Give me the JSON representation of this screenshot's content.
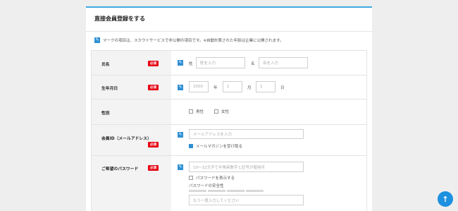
{
  "form": {
    "title": "直接会員登録をする",
    "notice": "マークの項目は、スカウトサービスで非公開の項目です。※自動計算された年齢は企業に公開されます。",
    "required_badge": "必須",
    "name": {
      "label": "氏名",
      "sei_label": "姓",
      "sei_placeholder": "姓を入力",
      "mei_label": "名",
      "mei_placeholder": "名を入力"
    },
    "birth": {
      "label": "生年月日",
      "year_placeholder": "2000",
      "year_unit": "年",
      "month_placeholder": "1",
      "month_unit": "月",
      "day_placeholder": "1",
      "day_unit": "日"
    },
    "gender": {
      "label": "性別",
      "options": [
        "男性",
        "女性"
      ]
    },
    "email": {
      "label": "会員ID（メールアドレス）",
      "placeholder": "メールアドレスを入力",
      "magazine_label": "メールマガジンを受け取る",
      "magazine_checked": true
    },
    "password": {
      "label": "ご希望のパスワード",
      "placeholder": "10～32文字で半角英数字と記号が使用可",
      "show_label": "パスワードを表示する",
      "strength_label": "パスワードの安全性",
      "confirm_placeholder": "もう一度入力してください"
    }
  },
  "icons": {
    "pen": "pencil-icon",
    "scroll_top": "arrow-up-icon"
  },
  "colors": {
    "accent": "#2f8fd3",
    "required": "#e60012",
    "top_border": "#3fa9e0",
    "fab": "#1e90e0"
  }
}
